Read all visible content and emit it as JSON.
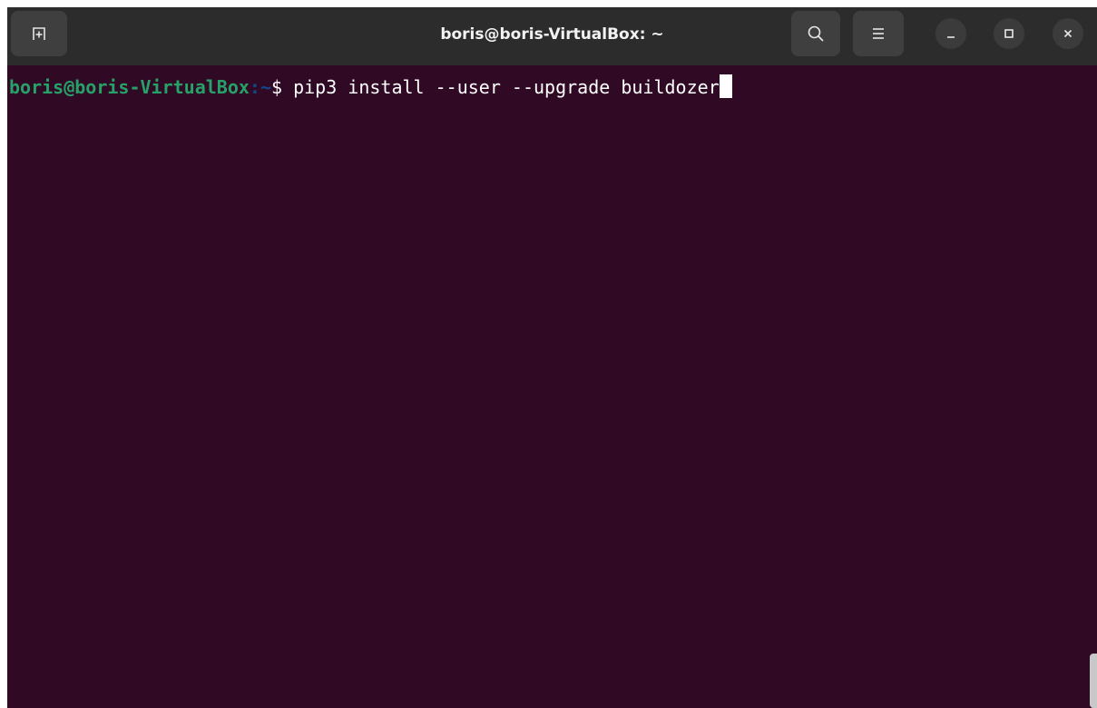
{
  "window": {
    "title": "boris@boris-VirtualBox: ~"
  },
  "titlebar": {
    "new_tab_icon": "new-tab-icon",
    "search_icon": "search-icon",
    "menu_icon": "hamburger-menu-icon",
    "minimize_icon": "minimize-icon",
    "maximize_icon": "maximize-icon",
    "close_icon": "close-icon"
  },
  "terminal": {
    "prompt_user_host": "boris@boris-VirtualBox",
    "prompt_colon": ":",
    "prompt_path": "~",
    "prompt_symbol": "$ ",
    "command": "pip3 install --user --upgrade buildozer"
  },
  "colors": {
    "background": "#300a24",
    "user_host": "#26a269",
    "path": "#12488b",
    "text": "#ffffff",
    "titlebar": "#2c2c2c"
  }
}
